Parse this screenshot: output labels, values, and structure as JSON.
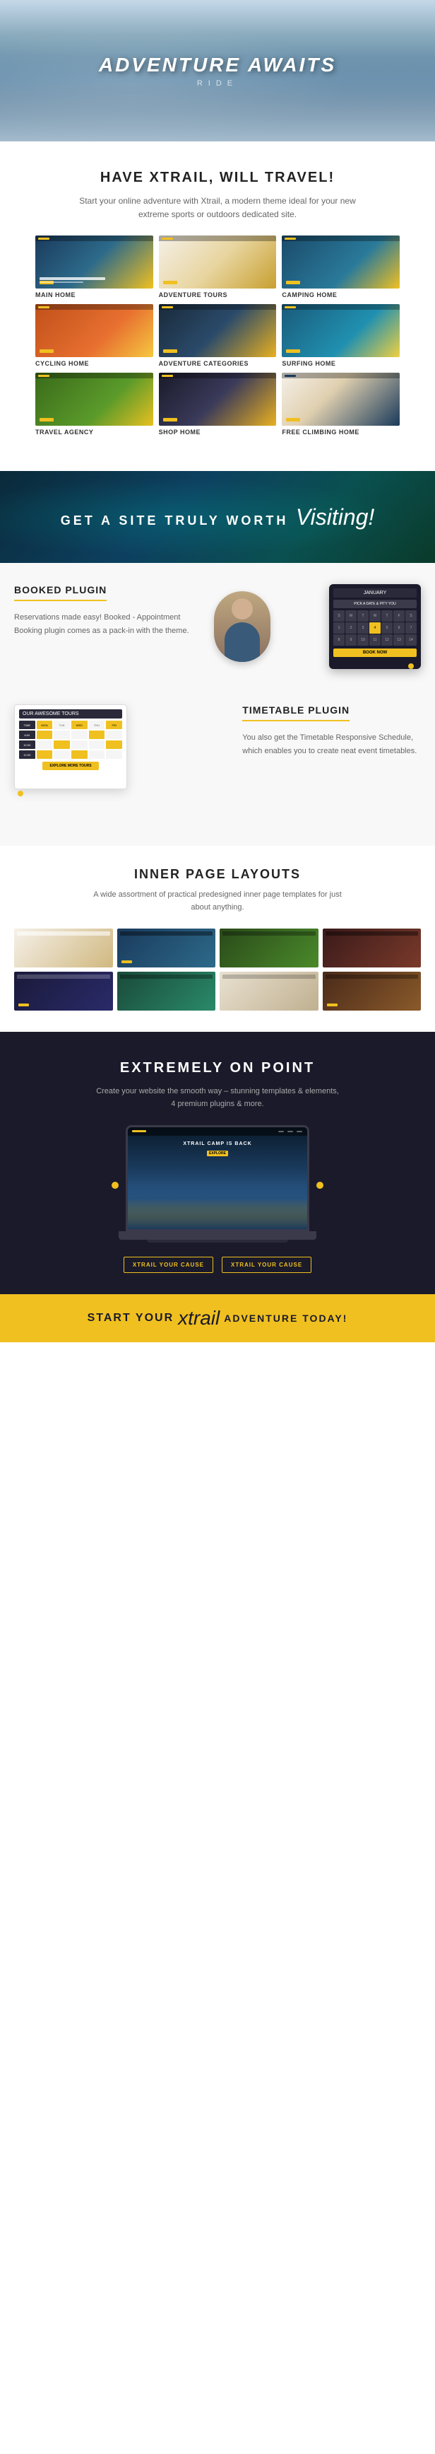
{
  "hero": {
    "title": "ADVENTURE AWAITS",
    "subtitle": "RIDE"
  },
  "xtrail_section": {
    "heading": "HAVE XTRAIL, WILL TRAVEL!",
    "description": "Start your online adventure with Xtrail, a modern theme ideal for your new extreme sports or outdoors dedicated site."
  },
  "demos": [
    {
      "label": "MAIN HOME",
      "thumb_class": "thumb-main-home"
    },
    {
      "label": "ADVENTURE TOURS",
      "thumb_class": "thumb-adventure-tours"
    },
    {
      "label": "CAMPING HOME",
      "thumb_class": "thumb-camping"
    },
    {
      "label": "CYCLING HOME",
      "thumb_class": "thumb-cycling"
    },
    {
      "label": "ADVENTURE CATEGORIES",
      "thumb_class": "thumb-adventure-cat"
    },
    {
      "label": "SURFING HOME",
      "thumb_class": "thumb-surfing"
    },
    {
      "label": "TRAVEL AGENCY",
      "thumb_class": "thumb-travel"
    },
    {
      "label": "SHOP HOME",
      "thumb_class": "thumb-shop"
    },
    {
      "label": "FREE CLIMBING HOME",
      "thumb_class": "thumb-free-climbing"
    }
  ],
  "visiting_section": {
    "prefix": "GET A SITE TRULY WORTH",
    "script": "Visiting!"
  },
  "booked_section": {
    "heading": "BOOKED PLUGIN",
    "description": "Reservations made easy! Booked - Appointment Booking plugin comes as a pack-in with the theme.",
    "calendar_month": "January",
    "calendar_prompt": "PICK A DATE & PITY YOU",
    "book_now": "BOOK NOW"
  },
  "timetable_section": {
    "heading": "TIMETABLE PLUGIN",
    "description": "You also get the Timetable Responsive Schedule, which enables you to create neat event timetables."
  },
  "inner_pages": {
    "heading": "INNER PAGE LAYOUTS",
    "description": "A wide assortment of practical predesigned inner page templates for just about anything."
  },
  "onpoint_section": {
    "heading": "EXTREMELY ON POINT",
    "description": "Create your website the smooth way – stunning templates & elements, 4 premium plugins & more.",
    "screen_title": "XTRAIL CAMP IS BACK",
    "btn1": "XTRAIL YOUR CAUSE",
    "btn2": "XTRAIL YOUR CAUSE"
  },
  "footer": {
    "prefix": "START YOUR",
    "script": "xtrail",
    "suffix": "ADVENTURE TODAY!"
  }
}
